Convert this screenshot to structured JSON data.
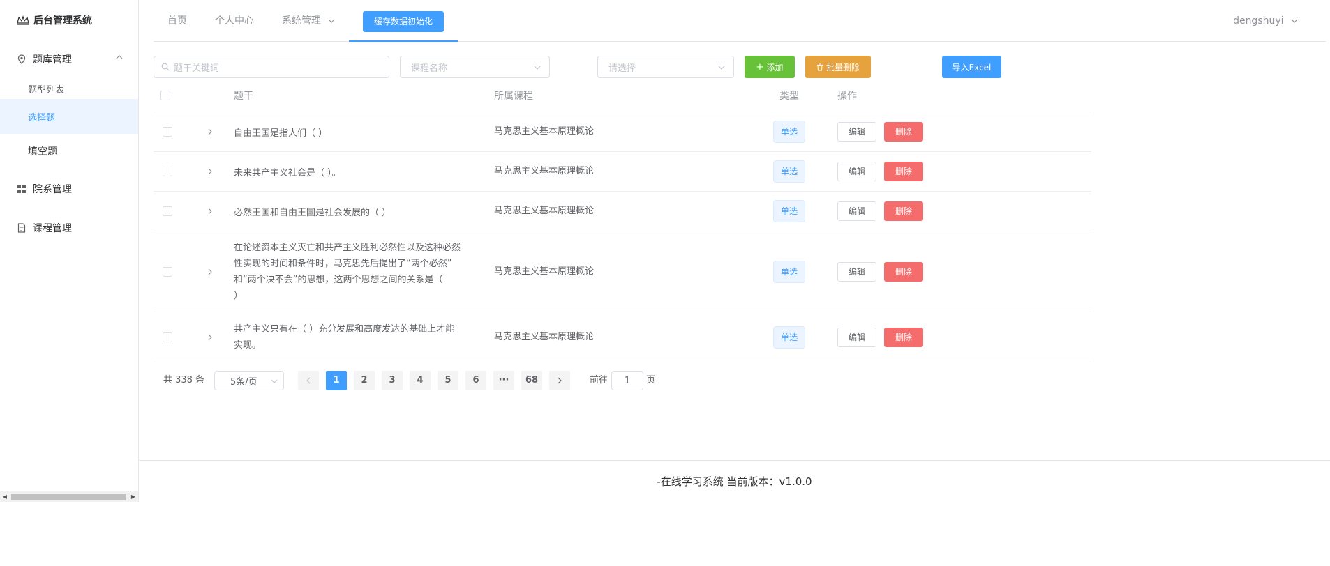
{
  "app": {
    "title": "后台管理系统"
  },
  "sidebar": {
    "menus": [
      {
        "label": "题库管理",
        "icon": "location-icon",
        "expanded": true,
        "children": [
          {
            "label": "题型列表"
          },
          {
            "label": "选择题",
            "active": true
          },
          {
            "label": "填空题"
          }
        ]
      },
      {
        "label": "院系管理",
        "icon": "grid-icon"
      },
      {
        "label": "课程管理",
        "icon": "document-icon"
      }
    ]
  },
  "nav": {
    "items": [
      "首页",
      "个人中心",
      "系统管理"
    ],
    "active": "缓存数据初始化",
    "user": "dengshuyi"
  },
  "filters": {
    "keyword_placeholder": "题干关键词",
    "course_placeholder": "课程名称",
    "select_placeholder": "请选择",
    "add_label": "添加",
    "batch_delete_label": "批量删除",
    "import_label": "导入Excel"
  },
  "table": {
    "headers": [
      "题干",
      "所属课程",
      "类型",
      "操作"
    ],
    "rows": [
      {
        "stem": [
          "自由王国是指人们（ ）"
        ],
        "course": "马克思主义基本原理概论",
        "type": "单选"
      },
      {
        "stem": [
          "未来共产主义社会是（ ）。"
        ],
        "course": "马克思主义基本原理概论",
        "type": "单选"
      },
      {
        "stem": [
          "必然王国和自由王国是社会发展的（ ）"
        ],
        "course": "马克思主义基本原理概论",
        "type": "单选"
      },
      {
        "stem": [
          "在论述资本主义灭亡和共产主义胜利必然性以及这种必然",
          "性实现的时间和条件时，马克思先后提出了“两个必然”",
          "和“两个决不会”的思想，这两个思想之间的关系是（",
          "）"
        ],
        "course": "马克思主义基本原理概论",
        "type": "单选"
      },
      {
        "stem": [
          "共产主义只有在（ ）充分发展和高度发达的基础上才能",
          "实现。"
        ],
        "course": "马克思主义基本原理概论",
        "type": "单选"
      }
    ],
    "edit_label": "编辑",
    "delete_label": "删除"
  },
  "pagination": {
    "total_text": "共 338 条",
    "page_size": "5条/页",
    "pages": [
      "1",
      "2",
      "3",
      "4",
      "5",
      "6",
      "···",
      "68"
    ],
    "current": "1",
    "goto_prefix": "前往",
    "goto_value": "1",
    "goto_suffix": "页"
  },
  "footer": {
    "text": "-在线学习系统 当前版本：v1.0.0"
  },
  "colors": {
    "primary": "#409eff",
    "success": "#67c23a",
    "warning": "#e6a23c",
    "danger": "#f56c6c"
  }
}
